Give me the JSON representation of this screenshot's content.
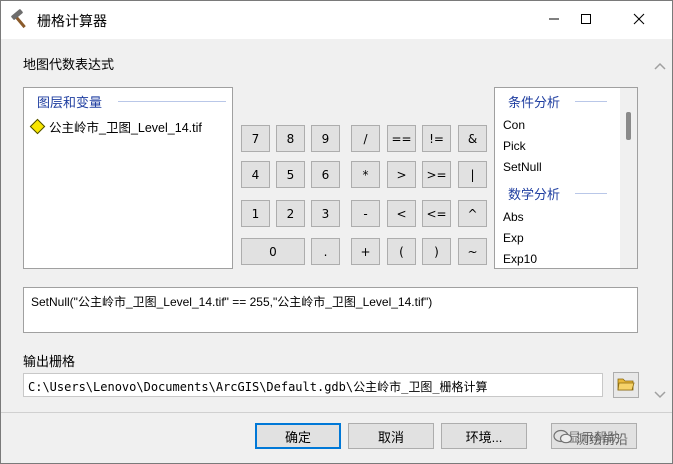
{
  "window": {
    "title": "栅格计算器",
    "controls": [
      "minimize-icon",
      "maximize-icon",
      "close-icon"
    ]
  },
  "expression_section_label": "地图代数表达式",
  "layers_panel": {
    "title": "图层和变量",
    "items": [
      "公主岭市_卫图_Level_14.tif"
    ]
  },
  "keypad": {
    "rows": [
      [
        "7",
        "8",
        "9",
        "/",
        "==",
        "!=",
        "&"
      ],
      [
        "4",
        "5",
        "6",
        "*",
        ">",
        ">=",
        "|"
      ],
      [
        "1",
        "2",
        "3",
        "-",
        "<",
        "<=",
        "^"
      ],
      [
        "0",
        ".",
        "+",
        "(",
        ")",
        "~"
      ]
    ]
  },
  "functions_panel": {
    "group1_title": "条件分析",
    "group1_items": [
      "Con",
      "Pick",
      "SetNull"
    ],
    "group2_title": "数学分析",
    "group2_items": [
      "Abs",
      "Exp",
      "Exp10"
    ]
  },
  "expression_text": "SetNull(\"公主岭市_卫图_Level_14.tif\" == 255,\"公主岭市_卫图_Level_14.tif\")",
  "output": {
    "label": "输出栅格",
    "value": "C:\\Users\\Lenovo\\Documents\\ArcGIS\\Default.gdb\\公主岭市_卫图_栅格计算"
  },
  "buttons": {
    "ok": "确定",
    "cancel": "取消",
    "environment": "环境...",
    "help": "显示帮助"
  },
  "watermark_text": "测绘前沿",
  "colors": {
    "group_title": "#1f3ea0",
    "default_button_border": "#0078d7",
    "layer_diamond": "#f8e600"
  }
}
